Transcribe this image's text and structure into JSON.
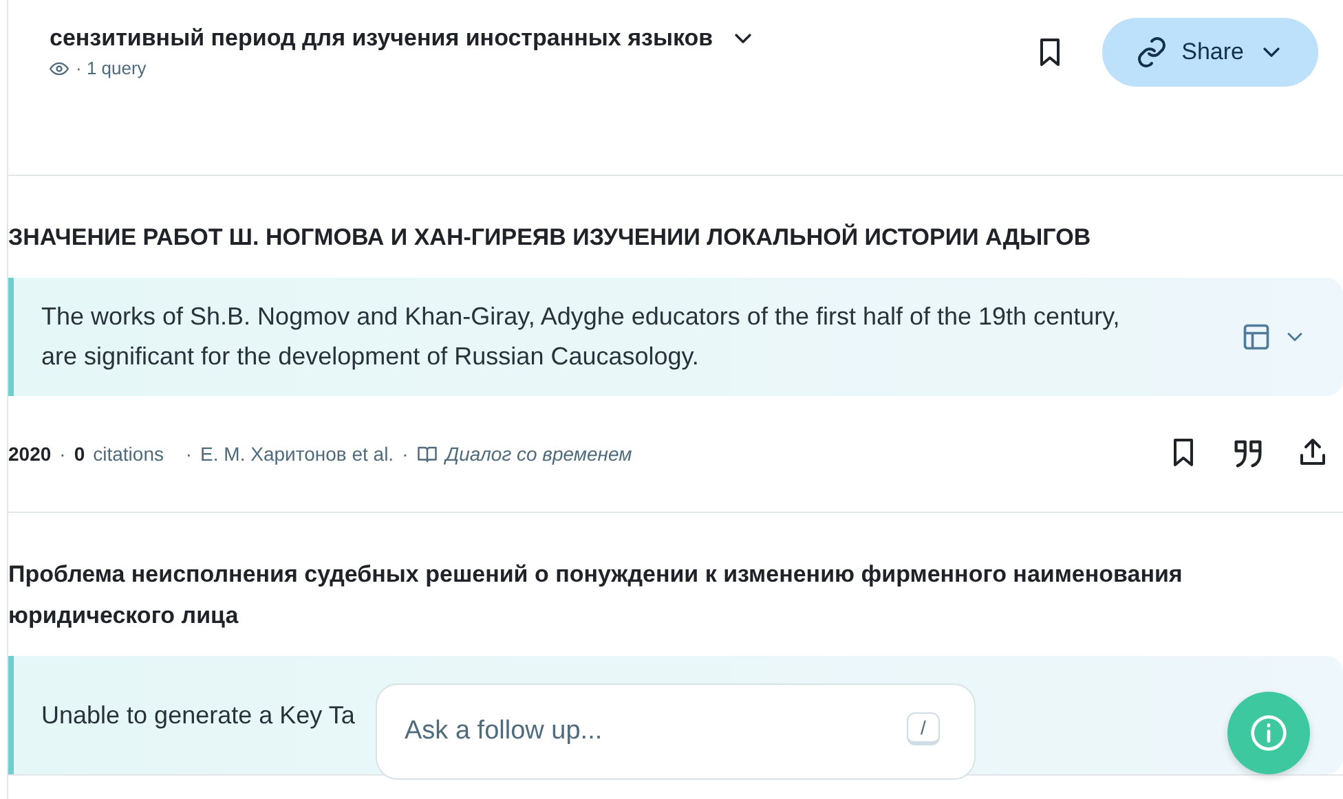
{
  "header": {
    "title": "сензитивный период для изучения иностранных языков",
    "queries": "· 1 query",
    "share": "Share"
  },
  "papers": [
    {
      "title": "ЗНАЧЕНИЕ РАБОТ Ш. НОГМОВА И ХАН-ГИРЕЯВ ИЗУЧЕНИИ ЛОКАЛЬНОЙ ИСТОРИИ АДЫГОВ",
      "summary": "The works of Sh.B. Nogmov and Khan-Giray, Adyghe educators of the first half of the 19th century, are significant for the development of Russian Caucasology.",
      "meta": {
        "year": "2020",
        "citations": "0",
        "citations_label": "citations",
        "authors": "Е. М. Харитонов et al.",
        "journal": "Диалог со временем",
        "separator": "·"
      }
    },
    {
      "title": "Проблема неисполнения судебных решений о понуждении к изменению фирменного наименования юридического лица",
      "summary": "Unable to generate a Key Ta"
    }
  ],
  "follow_up": {
    "placeholder": "Ask a follow up...",
    "shortcut": "/"
  }
}
